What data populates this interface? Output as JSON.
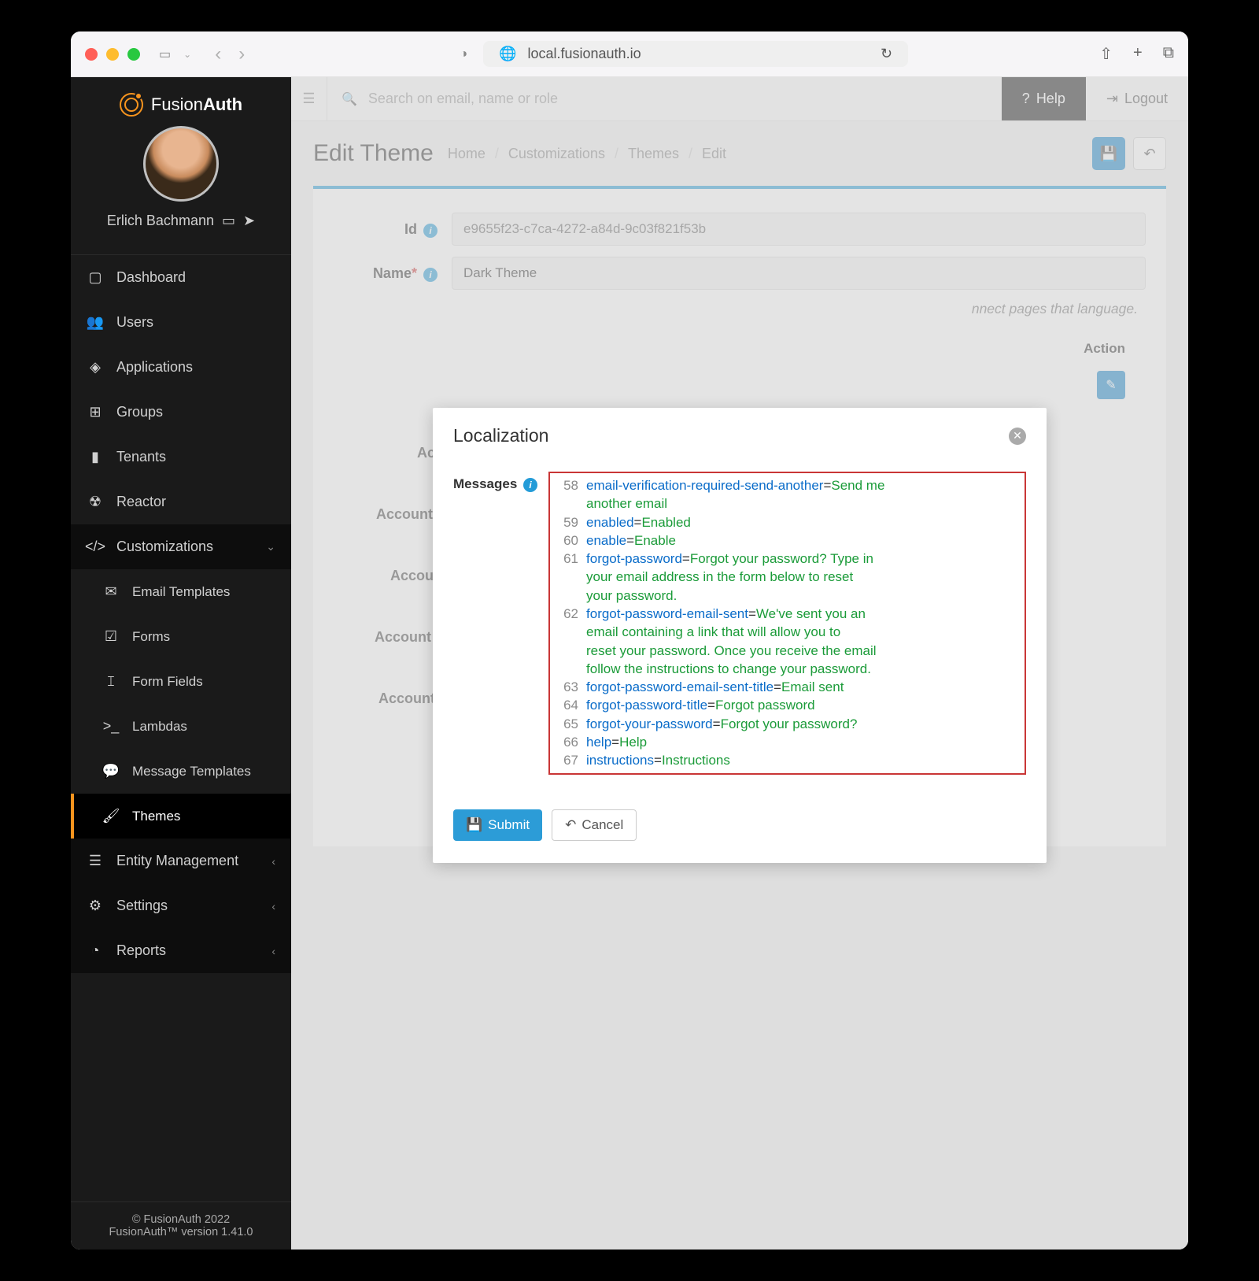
{
  "browser": {
    "url": "local.fusionauth.io"
  },
  "sidebar": {
    "brand": "FusionAuth",
    "username": "Erlich Bachmann",
    "nav": {
      "dashboard": "Dashboard",
      "users": "Users",
      "applications": "Applications",
      "groups": "Groups",
      "tenants": "Tenants",
      "reactor": "Reactor",
      "customizations": "Customizations",
      "email_templates": "Email Templates",
      "forms": "Forms",
      "form_fields": "Form Fields",
      "lambdas": "Lambdas",
      "message_templates": "Message Templates",
      "themes": "Themes",
      "entity_management": "Entity Management",
      "settings": "Settings",
      "reports": "Reports"
    },
    "footer": {
      "copyright": "© FusionAuth 2022",
      "version": "FusionAuth™ version 1.41.0"
    }
  },
  "topbar": {
    "search_placeholder": "Search on email, name or role",
    "help": "Help",
    "logout": "Logout"
  },
  "page": {
    "title": "Edit Theme",
    "crumbs": {
      "home": "Home",
      "customizations": "Customizations",
      "themes": "Themes",
      "edit": "Edit"
    },
    "form": {
      "id_label": "Id",
      "id_value": "e9655f23-c7ca-4272-a84d-9c03f821f53b",
      "name_label": "Name",
      "name_value": "Dark Theme",
      "help": "nnect pages that language."
    },
    "action_header": "Action",
    "templates": [
      "Account two-factor enable",
      "Account two-factor index",
      "Account add webauthn credential",
      "Account webauthn delete credential",
      "Account webauthn index"
    ]
  },
  "modal": {
    "title": "Localization",
    "messages_label": "Messages",
    "lines": [
      {
        "n": "58",
        "k": "email-verification-required-send-another",
        "v": "Send me another email"
      },
      {
        "n": "59",
        "k": "enabled",
        "v": "Enabled"
      },
      {
        "n": "60",
        "k": "enable",
        "v": "Enable"
      },
      {
        "n": "61",
        "k": "forgot-password",
        "v": "Forgot your password? Type in your email address in the form below to reset your password."
      },
      {
        "n": "62",
        "k": "forgot-password-email-sent",
        "v": "We've sent you an email containing a link that will allow you to reset your password. Once you receive the email follow the instructions to change your password."
      },
      {
        "n": "63",
        "k": "forgot-password-email-sent-title",
        "v": "Email sent"
      },
      {
        "n": "64",
        "k": "forgot-password-title",
        "v": "Forgot password"
      },
      {
        "n": "65",
        "k": "forgot-your-password",
        "v": "Forgot your password?"
      },
      {
        "n": "66",
        "k": "help",
        "v": "Help"
      },
      {
        "n": "67",
        "k": "instructions",
        "v": "Instructions"
      }
    ],
    "submit": "Submit",
    "cancel": "Cancel"
  }
}
